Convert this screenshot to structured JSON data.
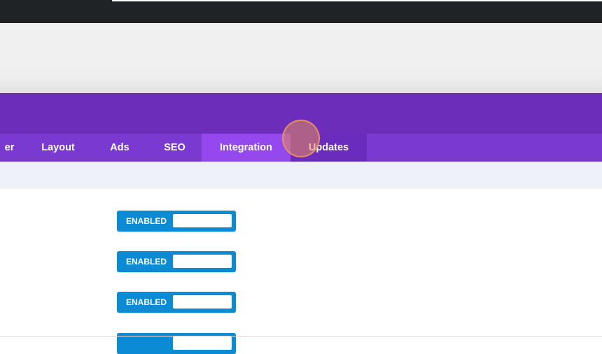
{
  "tabs": [
    {
      "label": "er",
      "state": "normal"
    },
    {
      "label": "Layout",
      "state": "normal"
    },
    {
      "label": "Ads",
      "state": "normal"
    },
    {
      "label": "SEO",
      "state": "normal"
    },
    {
      "label": "Integration",
      "state": "active"
    },
    {
      "label": "Updates",
      "state": "hover"
    }
  ],
  "toggles": [
    {
      "label": "ENABLED",
      "state": "enabled"
    },
    {
      "label": "ENABLED",
      "state": "enabled"
    },
    {
      "label": "ENABLED",
      "state": "enabled"
    },
    {
      "label": "",
      "state": "enabled"
    }
  ],
  "colors": {
    "topbar": "#1f2326",
    "header_purple": "#6c2dbb",
    "tab_bar": "#7a3ad1",
    "tab_active": "#9548ee",
    "toggle_blue": "#0c8bd4"
  }
}
